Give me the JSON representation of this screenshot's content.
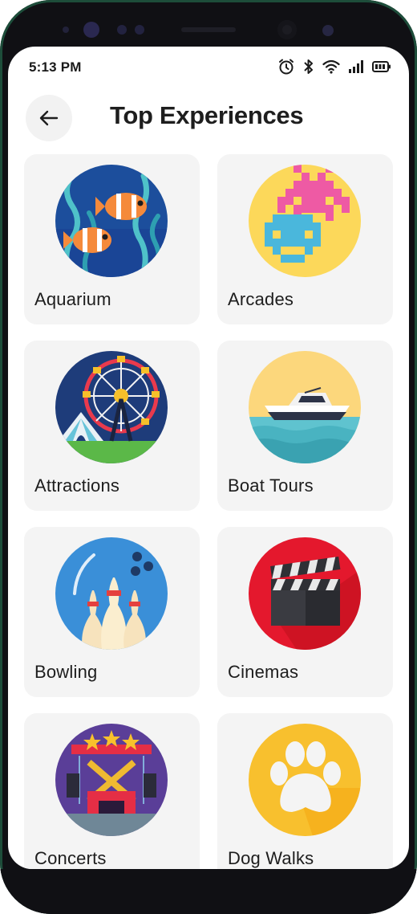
{
  "status_bar": {
    "time": "5:13 PM",
    "icons": [
      "alarm-icon",
      "bluetooth-icon",
      "wifi-icon",
      "signal-icon",
      "battery-icon"
    ]
  },
  "header": {
    "back_icon": "arrow-left-icon",
    "title": "Top Experiences"
  },
  "experiences": [
    {
      "label": "Aquarium",
      "icon": "aquarium-fish-illustration"
    },
    {
      "label": "Arcades",
      "icon": "arcade-space-invader-illustration"
    },
    {
      "label": "Attractions",
      "icon": "ferris-wheel-illustration"
    },
    {
      "label": "Boat Tours",
      "icon": "boat-illustration"
    },
    {
      "label": "Bowling",
      "icon": "bowling-illustration"
    },
    {
      "label": "Cinemas",
      "icon": "clapperboard-illustration"
    },
    {
      "label": "Concerts",
      "icon": "concert-stage-illustration"
    },
    {
      "label": "Dog Walks",
      "icon": "paw-print-illustration"
    }
  ],
  "colors": {
    "card_background": "#f4f4f4",
    "title_text": "#1e1e1e",
    "device_frame": "#101014"
  }
}
